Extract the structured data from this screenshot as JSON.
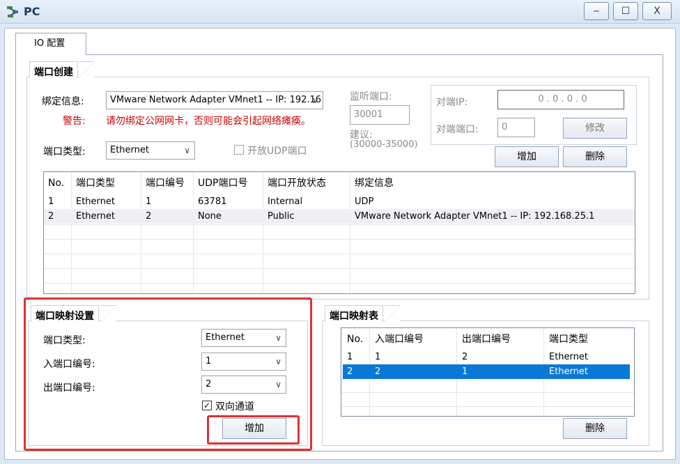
{
  "window": {
    "title": "PC",
    "minimize": "‒",
    "maximize": "☐",
    "close": "X"
  },
  "tab": {
    "label": "IO 配置"
  },
  "port_create": {
    "title": "端口创建",
    "bind_label": "绑定信息:",
    "bind_value": "VMware Network Adapter VMnet1 -- IP: 192.16",
    "warning_label": "警告:",
    "warning_text": "请勿绑定公网网卡，否则可能会引起网络瘫痪。",
    "port_type_label": "端口类型:",
    "port_type_value": "Ethernet",
    "udp_checkbox_label": "开放UDP端口",
    "listen_label": "监听端口:",
    "listen_value": "30001",
    "suggest_label": "建议:",
    "suggest_range": "(30000-35000)",
    "peer_ip_label": "对端IP:",
    "peer_ip_value": "0  .  0  .  0  .  0",
    "peer_port_label": "对端端口:",
    "peer_port_value": "0",
    "modify_button": "修改",
    "add_button": "增加",
    "delete_button": "删除",
    "table": {
      "headers": [
        "No.",
        "端口类型",
        "端口编号",
        "UDP端口号",
        "端口开放状态",
        "绑定信息"
      ],
      "rows": [
        [
          "1",
          "Ethernet",
          "1",
          "63781",
          "Internal",
          "UDP"
        ],
        [
          "2",
          "Ethernet",
          "2",
          "None",
          "Public",
          "VMware Network Adapter VMnet1 -- IP: 192.168.25.1"
        ]
      ]
    }
  },
  "mapping_settings": {
    "title": "端口映射设置",
    "port_type_label": "端口类型:",
    "port_type_value": "Ethernet",
    "in_port_label": "入端口编号:",
    "in_port_value": "1",
    "out_port_label": "出端口编号:",
    "out_port_value": "2",
    "bidirectional_label": "双向通道",
    "add_button": "增加"
  },
  "mapping_table": {
    "title": "端口映射表",
    "headers": [
      "No.",
      "入端口编号",
      "出端口编号",
      "端口类型"
    ],
    "rows": [
      [
        "1",
        "1",
        "2",
        "Ethernet"
      ],
      [
        "2",
        "2",
        "1",
        "Ethernet"
      ]
    ],
    "delete_button": "删除"
  },
  "colors": {
    "highlight": "#e23030",
    "selection": "#0a78d7",
    "warning": "#d00000"
  }
}
